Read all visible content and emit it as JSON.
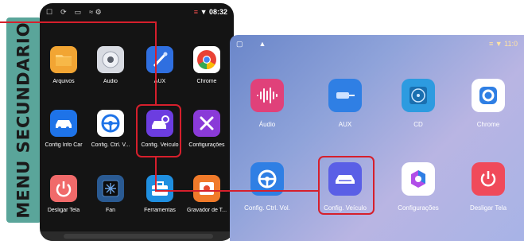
{
  "banner": {
    "text": "MENU SECUNDARIO"
  },
  "phone": {
    "status": {
      "left_icons": [
        "☐",
        "⟳",
        "▭"
      ],
      "mid": "≈ ⚙",
      "signal": "≡",
      "time": "▼ 08:32"
    },
    "apps": [
      {
        "label": "Arquivos",
        "icon": "folder-icon",
        "bg": "#f2a533"
      },
      {
        "label": "Áudio",
        "icon": "audio-icon",
        "bg": "#d8dbe2"
      },
      {
        "label": "AUX",
        "icon": "aux-cable-icon",
        "bg": "#2f6fe0"
      },
      {
        "label": "Chrome",
        "icon": "chrome-icon",
        "bg": "#ffffff"
      },
      {
        "label": "Config Info Car",
        "icon": "car-info-icon",
        "bg": "#1e73e8"
      },
      {
        "label": "Config. Ctrl. V...",
        "icon": "steering-wheel-icon",
        "bg": "#ffffff"
      },
      {
        "label": "Config. Veículo",
        "icon": "vehicle-settings-icon",
        "bg": "#6c3de0"
      },
      {
        "label": "Configurações",
        "icon": "tools-icon",
        "bg": "#8a3ad8"
      },
      {
        "label": "Desligar Tela",
        "icon": "power-icon",
        "bg": "#f06a6a"
      },
      {
        "label": "Fan",
        "icon": "fan-icon",
        "bg": "#2a5a92"
      },
      {
        "label": "Ferramentas",
        "icon": "toolbox-icon",
        "bg": "#1f8fe0"
      },
      {
        "label": "Gravador de T...",
        "icon": "recorder-icon",
        "bg": "#f07a2a"
      }
    ]
  },
  "tablet": {
    "status": {
      "left": "▢",
      "mid": "▲",
      "time": "≡ ▼ 11:0"
    },
    "apps": [
      {
        "label": "Áudio",
        "icon": "audio-wave-icon",
        "bg": "#e0417a"
      },
      {
        "label": "AUX",
        "icon": "aux-cable-icon",
        "bg": "#2f7fe4"
      },
      {
        "label": "CD",
        "icon": "cd-icon",
        "bg": "#2d9be0"
      },
      {
        "label": "Chrome",
        "icon": "chrome-icon",
        "bg": "#ffffff"
      },
      {
        "label": "Config. Ctrl. Vol.",
        "icon": "steering-wheel-icon",
        "bg": "#2f7fe4"
      },
      {
        "label": "Config. Veículo",
        "icon": "vehicle-settings-icon",
        "bg": "#5a5fe6"
      },
      {
        "label": "Configurações",
        "icon": "settings-icon",
        "bg": "#ffffff"
      },
      {
        "label": "Desligar Tela",
        "icon": "power-icon",
        "bg": "#f04a5a"
      }
    ]
  },
  "colors": {
    "highlight": "#d61f2c",
    "banner": "#5aa59a"
  }
}
